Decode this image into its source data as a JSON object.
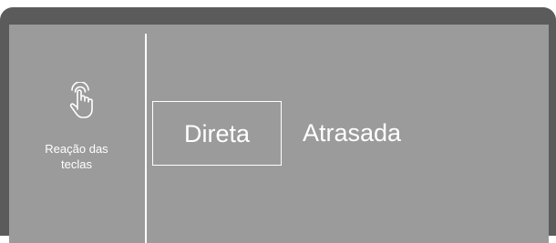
{
  "sidebar": {
    "icon": "touch-hand-icon",
    "label": "Reação das\nteclas"
  },
  "options": [
    {
      "label": "Direta",
      "selected": true
    },
    {
      "label": "Atrasada",
      "selected": false
    }
  ],
  "colors": {
    "frame": "#5b5b5b",
    "screen": "#9b9b9c",
    "text": "#ffffff"
  }
}
